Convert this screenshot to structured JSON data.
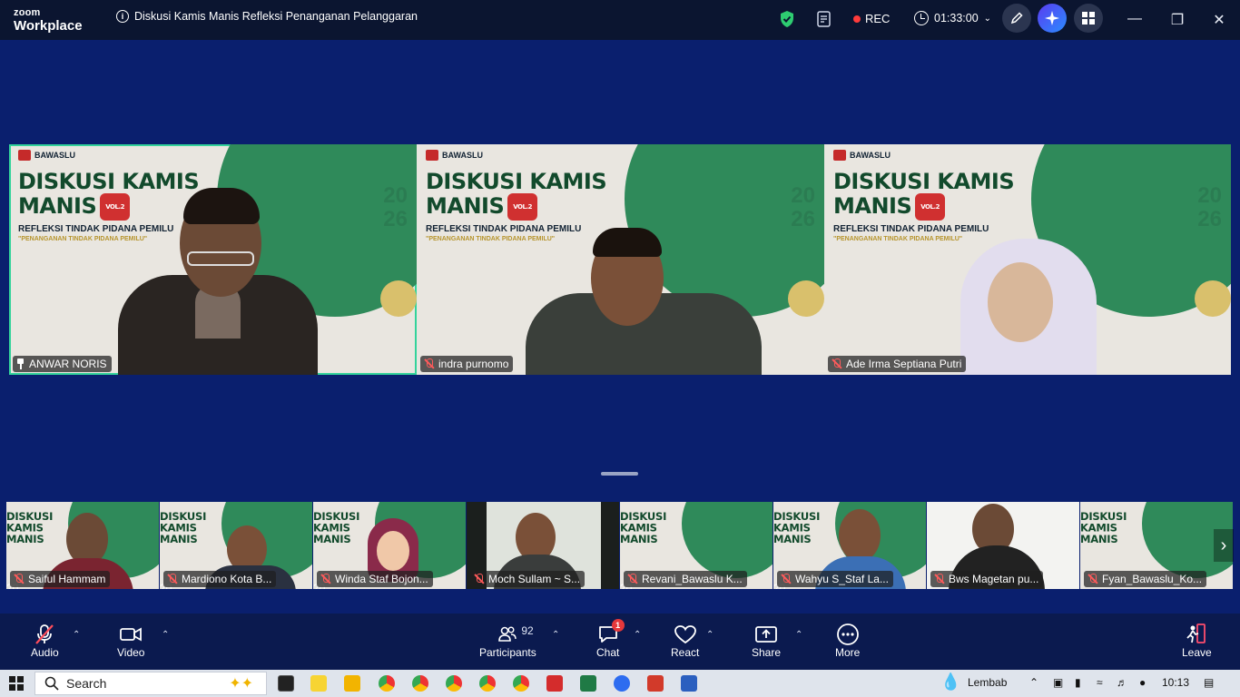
{
  "titlebar": {
    "logo_top": "zoom",
    "logo_bottom": "Workplace",
    "meeting_title": "Diskusi Kamis Manis Refleksi Penanganan Pelanggaran",
    "rec_label": "REC",
    "timer": "01:33:00",
    "colors": {
      "rec": "#ff3b3b",
      "shield": "#2ecc71"
    }
  },
  "gallery": [
    {
      "name": "ANWAR NORIS",
      "status": "pinned",
      "active": true
    },
    {
      "name": "indra purnomo",
      "status": "muted",
      "active": false
    },
    {
      "name": "Ade Irma Septiana Putri",
      "status": "muted",
      "active": false
    }
  ],
  "poster": {
    "brand": "BAWASLU",
    "title_1": "DISKUSI KAMIS",
    "title_2": "MANIS",
    "vol": "VOL.2",
    "subtitle": "REFLEKSI TINDAK PIDANA PEMILU",
    "tagline": "\"PENANGANAN TINDAK PIDANA PEMILU\"",
    "year_1": "20",
    "year_2": "26"
  },
  "strip": [
    {
      "name": "Saiful Hammam"
    },
    {
      "name": "Mardiono Kota B..."
    },
    {
      "name": "Winda Staf Bojon..."
    },
    {
      "name": "Moch Sullam ~ S..."
    },
    {
      "name": "Revani_Bawaslu K..."
    },
    {
      "name": "Wahyu S_Staf La..."
    },
    {
      "name": "Bws Magetan pu..."
    },
    {
      "name": "Fyan_Bawaslu_Ko..."
    }
  ],
  "toolbar": {
    "audio": "Audio",
    "video": "Video",
    "participants": "Participants",
    "participants_count": "92",
    "chat": "Chat",
    "chat_badge": "1",
    "react": "React",
    "share": "Share",
    "more": "More",
    "leave": "Leave"
  },
  "taskbar": {
    "search_placeholder": "Search",
    "weather": "Lembab",
    "time": "10:13"
  }
}
